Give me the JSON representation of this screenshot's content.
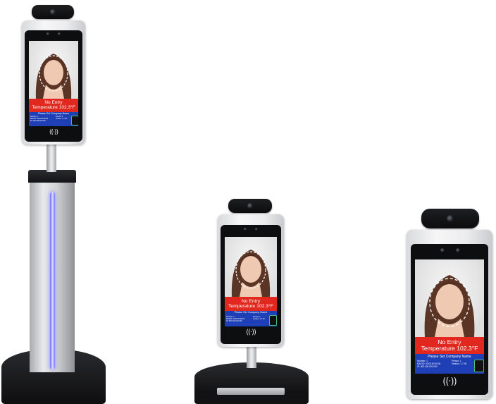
{
  "devices": [
    {
      "id": "tall-stand",
      "banner": {
        "line1": "No Entry",
        "line2": "Temperature 102.3°F"
      },
      "info": {
        "company": "Please Set Company Name",
        "detail_left": "Number: 1\nMACID: 00:00:00:00:00\nIP: 000.000.000.000",
        "detail_right": "Person: 1\nVersion: 1.7.00"
      }
    },
    {
      "id": "desk-stand",
      "banner": {
        "line1": "No Entry",
        "line2": "Temperature 102.3°F"
      },
      "info": {
        "company": "Please Set Company Name",
        "detail_left": "Number: 1\nMACID: 00:00:00:00:00\nIP: 000.000.000.000",
        "detail_right": "Person: 1\nVersion: 1.7.00"
      }
    },
    {
      "id": "wall-mount",
      "banner": {
        "line1": "No Entry",
        "line2": "Temperature 102.3°F"
      },
      "info": {
        "company": "Please Set Company Name",
        "detail_left": "Number: 1\nMACID: 00:00:00:00:00\nIP: 000.000.000.000",
        "detail_right": "Person: 1\nVersion: 1.7.00"
      }
    }
  ],
  "nfc_glyph": "((·))",
  "colors": {
    "alert_red": "#e2271e",
    "info_blue": "#1f3fb6",
    "stand_glow": "#8d8cff",
    "bezel": "#0d0e10"
  }
}
